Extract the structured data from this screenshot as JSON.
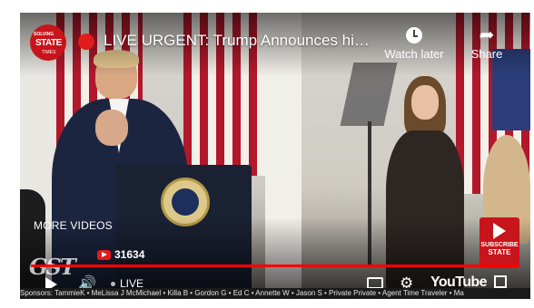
{
  "video": {
    "title": "LIVE URGENT: Trump Announces hi…",
    "channel_logo": {
      "line1": "SOLVING",
      "line2": "STATE",
      "line3": "TIMES",
      "color": "#c8141b"
    },
    "watch_later_label": "Watch later",
    "share_label": "Share",
    "more_videos_label": "MORE VIDEOS",
    "subscriber_count": "31634",
    "watermark": "GST",
    "subscribe_badge": {
      "line1": "SUBSCRIBE",
      "line2": "STATE"
    },
    "progress": 1.0,
    "live_label": "LIVE",
    "brand_logo_text": "YouTube",
    "ticker_text": "Sponsors: TammieK • MeLissa J McMichael • Killa B • Gordon G • Ed C • Annette W • Jason S • Private Private • Agent Time Traveler • Ma",
    "accent_color": "#ff0000"
  },
  "icons": {
    "live_dot": "red-live-dot-icon",
    "watch_later": "clock-icon",
    "share": "share-arrow-icon",
    "play": "play-icon",
    "volume": "volume-icon",
    "captions": "captions-icon",
    "settings": "gear-icon",
    "fullscreen": "fullscreen-icon"
  }
}
